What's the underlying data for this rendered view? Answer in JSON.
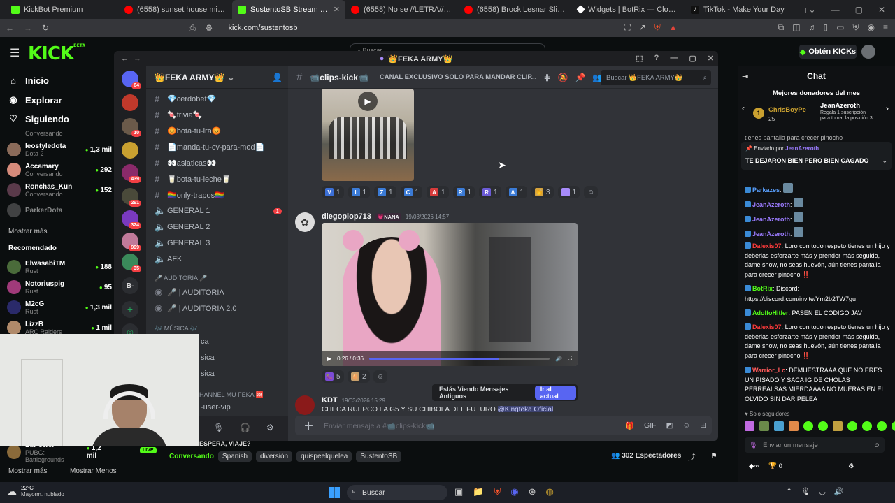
{
  "browser": {
    "tabs": [
      {
        "title": "KickBot Premium",
        "color": "#53fc18"
      },
      {
        "title": "(6558) sunset house mix - YouTube",
        "color": "#ff0000"
      },
      {
        "title": "SustentoSB Stream - Watch L",
        "color": "#53fc18"
      },
      {
        "title": "(6558) No se //LETRA// El Clon Tech",
        "color": "#ff0000"
      },
      {
        "title": "(6558) Brock Lesnar Slips and Falls d",
        "color": "#ff0000"
      },
      {
        "title": "Widgets | BotRix — Cloud Streaming",
        "color": "#ffffff"
      },
      {
        "title": "TikTok - Make Your Day",
        "color": "#111111"
      }
    ],
    "url": "kick.com/sustentosb"
  },
  "kick": {
    "logo": "KICK",
    "logo_sup": "BETA",
    "nav": [
      "Inicio",
      "Explorar",
      "Siguiendo"
    ],
    "followed": [
      {
        "name": "leostyledota",
        "sub": "Dota 2",
        "viewers": "1,3 mil"
      },
      {
        "name": "Accamary",
        "sub": "Conversando",
        "viewers": "292"
      },
      {
        "name": "Ronchas_Kun",
        "sub": "Conversando",
        "viewers": "152"
      },
      {
        "name": "ParkerDota",
        "sub": "",
        "viewers": ""
      }
    ],
    "followed_top_partial": "Conversando",
    "show_more": "Mostrar más",
    "recommended_label": "Recomendado",
    "recommended": [
      {
        "name": "ElwasabiTM",
        "sub": "Rust",
        "viewers": "188"
      },
      {
        "name": "Notoriuspig",
        "sub": "Rust",
        "viewers": "95"
      },
      {
        "name": "M2cG",
        "sub": "Rust",
        "viewers": "1,3 mil"
      },
      {
        "name": "LizzB",
        "sub": "ARC Raiders",
        "viewers": "1 mil"
      }
    ],
    "bottom_streamer": {
      "name": "LuPower",
      "sub": "PUBG: Battlegrounds",
      "viewers": "1,2 mil",
      "live": "LIVE"
    },
    "bottom_more": "Mostrar más",
    "bottom_less": "Mostrar Menos",
    "obten": "Obtén KICKs",
    "search_placeholder": "Buscar",
    "stream_title_partial": "ESPERA, VIAJE?",
    "tags": [
      "Conversando",
      "Spanish",
      "diversión",
      "quispeelquelea",
      "SustentoSB"
    ],
    "spectators": "302 Espectadores"
  },
  "discord": {
    "window_title": "👑FEKA ARMY👑",
    "server_name": "👑FEKA ARMY👑",
    "server_badges": [
      "64",
      "10",
      "439",
      "291",
      "324",
      "999",
      "35"
    ],
    "server_b_label": "B-",
    "channels": [
      {
        "name": "💎cerdobet💎",
        "type": "text"
      },
      {
        "name": "🍬trivia🍬",
        "type": "text"
      },
      {
        "name": "😡bota-tu-ira😡",
        "type": "text"
      },
      {
        "name": "📄manda-tu-cv-para-mod📄",
        "type": "text"
      },
      {
        "name": "👀asiaticas👀",
        "type": "text"
      },
      {
        "name": "🥛bota-tu-leche🥛",
        "type": "text"
      },
      {
        "name": "🏳️‍🌈only-trapos🏳️‍🌈",
        "type": "text"
      },
      {
        "name": "GENERAL 1",
        "type": "voice",
        "badge": "1"
      },
      {
        "name": "GENERAL 2",
        "type": "voice"
      },
      {
        "name": "GENERAL 3",
        "type": "voice"
      },
      {
        "name": "AFK",
        "type": "voice"
      }
    ],
    "cat_auditoria": "🎤 AUDITORÍA 🎤",
    "auditoria_channels": [
      "🎤 | AUDITORIA",
      "🎤 | AUDITORIA 2.0"
    ],
    "cat_musica": "🎶 MÚSICA 🎶",
    "musica_partial": [
      "ca",
      "sica",
      "sica"
    ],
    "cat_channel": "HANNEL MU FEKA 🆘",
    "user_vip_partial": "-user-vip",
    "channel_name": "📹clips-kick📹",
    "channel_topic": "CANAL EXCLUSIVO SOLO PARA MANDAR CLIP...",
    "search_placeholder": "Buscar 👑FEKA ARMY👑",
    "reactions1": [
      {
        "e": "V",
        "c": "#3b6fd6",
        "n": "1"
      },
      {
        "e": "I",
        "c": "#3b7bd6",
        "n": "1"
      },
      {
        "e": "Z",
        "c": "#3b7bd6",
        "n": "1"
      },
      {
        "e": "C",
        "c": "#3b7bd6",
        "n": "1"
      },
      {
        "e": "A",
        "c": "#d63b3b",
        "n": "1"
      },
      {
        "e": "R",
        "c": "#3b7bd6",
        "n": "1"
      },
      {
        "e": "R",
        "c": "#6b5bd6",
        "n": "1"
      },
      {
        "e": "A",
        "c": "#3b7bd6",
        "n": "1"
      },
      {
        "e": "👏",
        "c": "#d6a33b",
        "n": "3"
      },
      {
        "e": "",
        "c": "#a78bfa",
        "n": "1"
      }
    ],
    "msg2": {
      "author": "diegoplop713",
      "role": "💗NANA",
      "date": "19/03/2026 14:57"
    },
    "video": {
      "time": "0:26 / 0:36",
      "progress": 0.72
    },
    "reactions2": [
      {
        "e": "🍆",
        "c": "#7b4bd6",
        "n": "5"
      },
      {
        "e": "🥚",
        "c": "#c9a06b",
        "n": "2"
      }
    ],
    "msg3": {
      "author": "KDT",
      "date": "19/03/2026 15:29",
      "text": "CHECA RUEPCO LA G5 Y SU CHIBOLA DEL FUTURO",
      "mention": "@Kingteka Oficial"
    },
    "old_msgs": "Estás Viendo Mensajes Antiguos",
    "jump_btn": "Ir al actual",
    "input_placeholder": "Enviar mensaje a #📹clips-kick📹"
  },
  "chat": {
    "title": "Chat",
    "top_donors_title": "Mejores donadores del mes",
    "donor1": {
      "name": "ChrisBoyPe",
      "amount": "25"
    },
    "donor2": {
      "name": "JeanAzeroth",
      "note": "Regala 1 suscripción para tomar la posición 3"
    },
    "pinned_partial": "tienes pantalla para crecer pinocho",
    "pinned_by": "Enviado por",
    "pinned_user": "JeanAzeroth",
    "pinned_text": "TE DEJARON BIEN PERO BIEN CAGADO",
    "messages": [
      {
        "user": "Parkazes",
        "color": "#5aa0ff",
        "text": ""
      },
      {
        "user": "JeanAzeroth",
        "color": "#9b7bff",
        "text": ""
      },
      {
        "user": "JeanAzeroth",
        "color": "#9b7bff",
        "text": ""
      },
      {
        "user": "JeanAzeroth",
        "color": "#9b7bff",
        "text": ""
      },
      {
        "user": "Dalexis07",
        "color": "#ff3b3b",
        "text": "Loro con todo respeto tienes un hijo y deberias esforzarte más y prender más seguido, dame show, no seas huevón, aún tienes pantalla para crecer pinocho ‼️"
      },
      {
        "user": "BotRix",
        "color": "#53fc18",
        "text": "Discord:"
      },
      {
        "user": "",
        "color": "#ffffff",
        "text": "https://discord.com/invite/Ym2b2TW7gu"
      },
      {
        "user": "AdolfoHitler",
        "color": "#53fc18",
        "text": "PASEN EL CODIGO JAV"
      },
      {
        "user": "Dalexis07",
        "color": "#ff3b3b",
        "text": "Loro con todo respeto tienes un hijo y deberias esforzarte más y prender más seguido, dame show, no seas huevón, aún tienes pantalla para crecer pinocho ‼️"
      },
      {
        "user": "Warrior_Lc",
        "color": "#ff5a5a",
        "text": "DEMUESTRAAA QUE NO ERES UN PISADO Y SACA IG DE CHOLAS PERREALSAS MIERDAAAA NO MUERAS EN EL OLVIDO SIN DAR PELEA"
      }
    ],
    "followers_only": "Solo seguidores",
    "input_placeholder": "Enviar un mensaje",
    "bottom_count1": "0",
    "bottom_count2": "0"
  },
  "taskbar": {
    "weather_temp": "22°C",
    "weather_desc": "Mayorm. nublado",
    "search": "Buscar"
  }
}
